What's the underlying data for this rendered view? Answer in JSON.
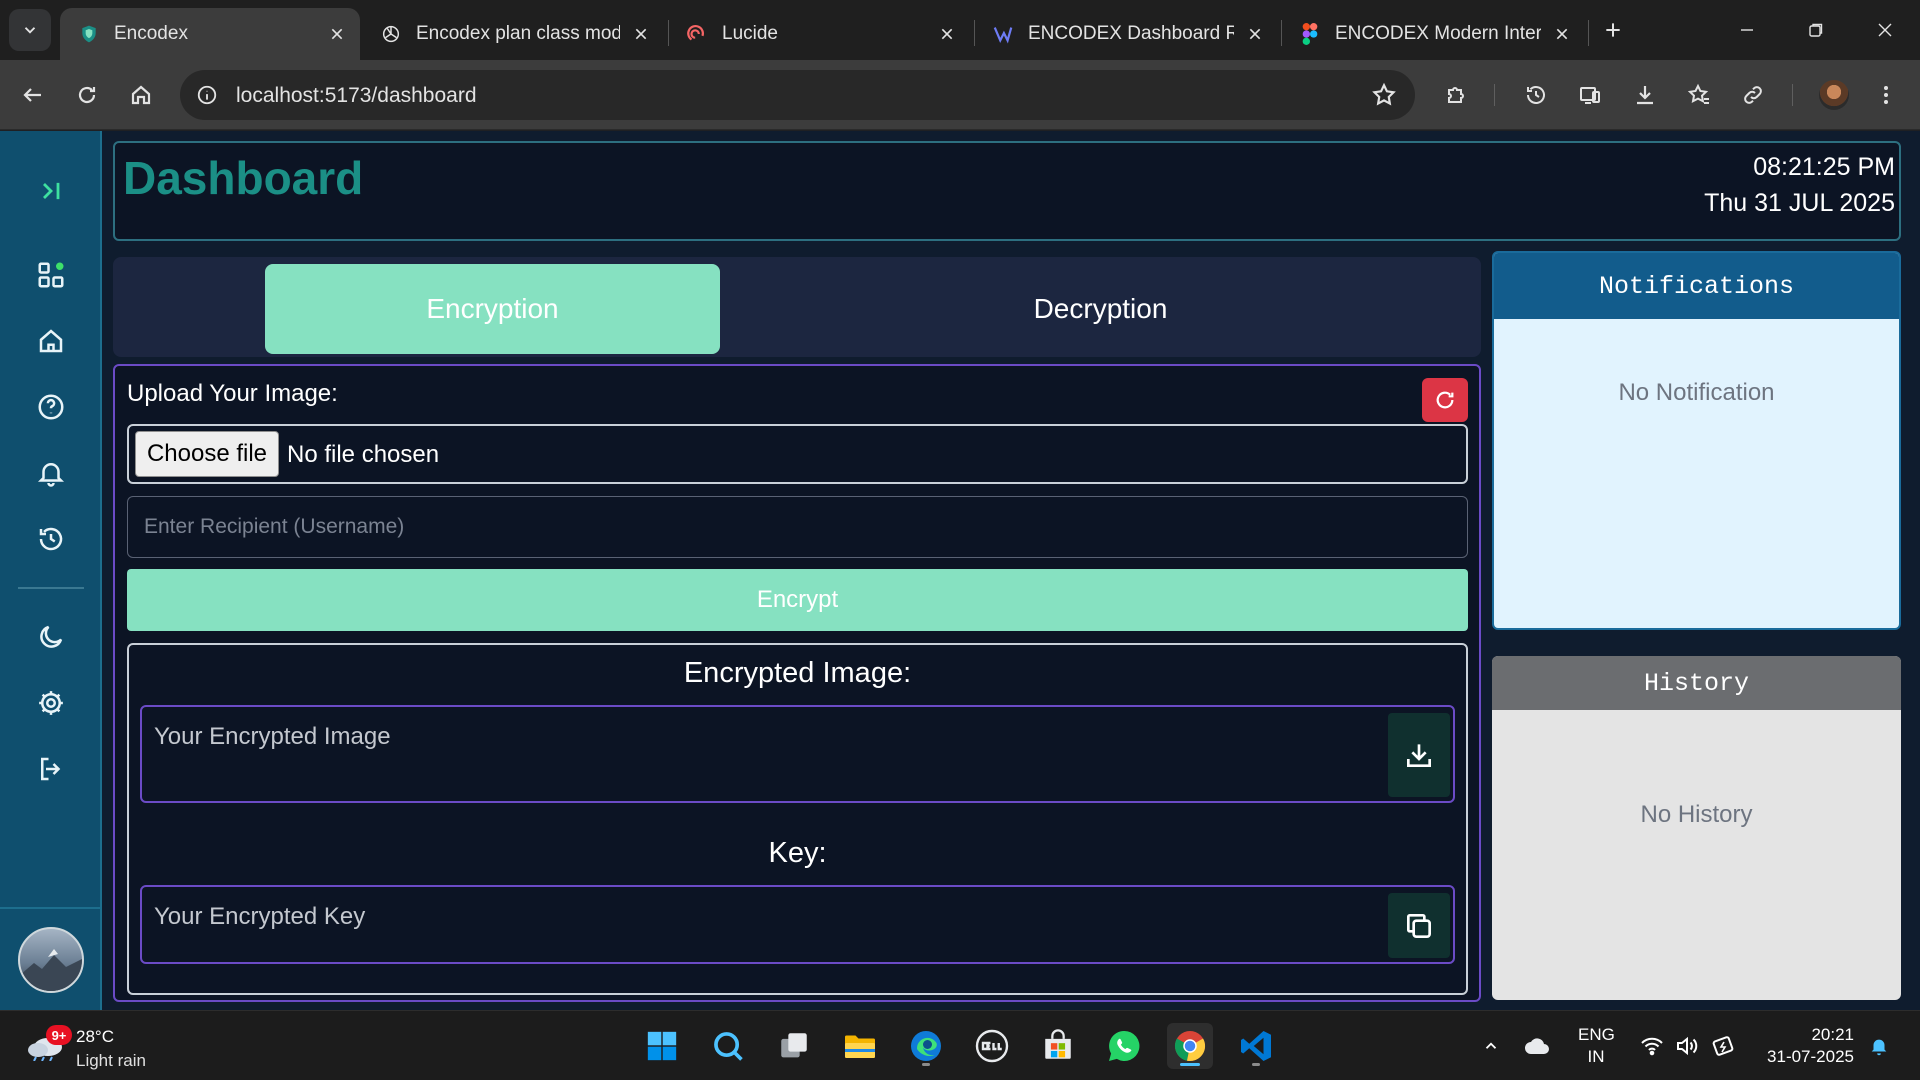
{
  "browser": {
    "tabs": [
      {
        "title": "Encodex",
        "active": true
      },
      {
        "title": "Encodex plan class mode"
      },
      {
        "title": "Lucide"
      },
      {
        "title": "ENCODEX Dashboard Re"
      },
      {
        "title": "ENCODEX Modern Interf"
      }
    ],
    "url": "localhost:5173/dashboard"
  },
  "header": {
    "title": "Dashboard",
    "time": "08:21:25 PM",
    "date": "Thu 31 JUL 2025"
  },
  "mode_tabs": {
    "encryption": "Encryption",
    "decryption": "Decryption"
  },
  "upload": {
    "label": "Upload Your Image:",
    "choose_file": "Choose file",
    "no_file": "No file chosen",
    "recipient_placeholder": "Enter Recipient (Username)",
    "encrypt_label": "Encrypt"
  },
  "result": {
    "image_heading": "Encrypted Image:",
    "image_placeholder": "Your Encrypted Image",
    "key_heading": "Key:",
    "key_placeholder": "Your Encrypted Key"
  },
  "notifications": {
    "title": "Notifications",
    "empty": "No Notification"
  },
  "history": {
    "title": "History",
    "empty": "No History"
  },
  "taskbar": {
    "weather_temp": "28°C",
    "weather_cond": "Light rain",
    "weather_badge": "9+",
    "lang_line1": "ENG",
    "lang_line2": "IN",
    "clock_time": "20:21",
    "clock_date": "31-07-2025"
  },
  "colors": {
    "accent_green": "#86e1c1",
    "title_teal": "#1b8f86",
    "sidebar": "#0f4f6e",
    "danger": "#dc3545",
    "panel_border": "#6b4bc6"
  }
}
